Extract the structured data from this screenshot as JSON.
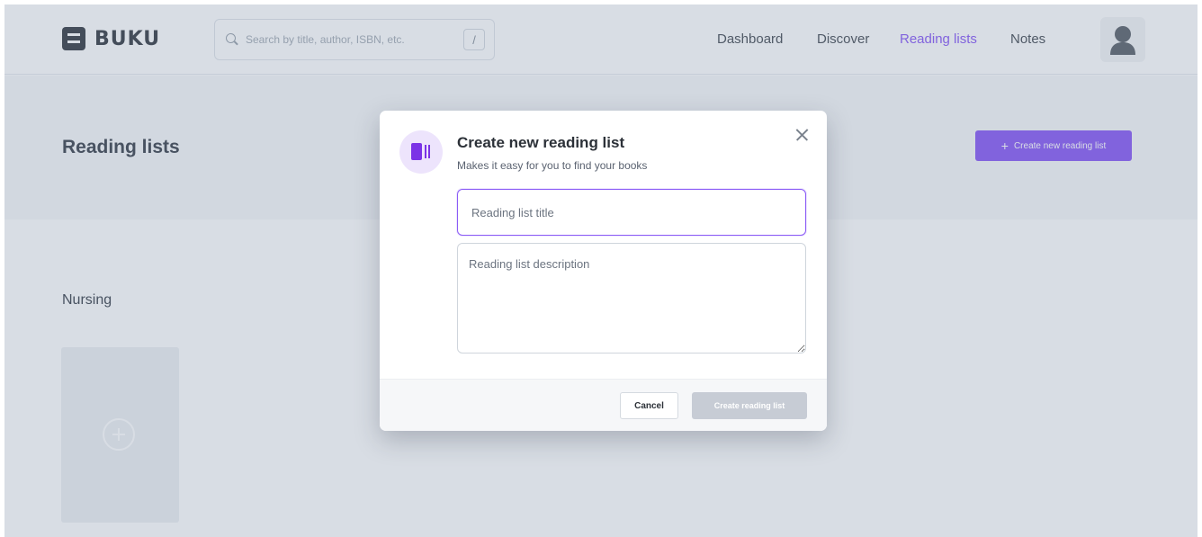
{
  "header": {
    "brand": "BUKU",
    "search_placeholder": "Search by title, author, ISBN, etc.",
    "search_shortcut": "/",
    "nav": [
      {
        "label": "Dashboard",
        "active": false
      },
      {
        "label": "Discover",
        "active": false
      },
      {
        "label": "Reading lists",
        "active": true
      },
      {
        "label": "Notes",
        "active": false
      }
    ]
  },
  "page": {
    "title": "Reading lists",
    "create_button_label": "Create new reading list",
    "section_title": "Nursing"
  },
  "modal": {
    "title": "Create new reading list",
    "subtitle": "Makes it easy for you to find your books",
    "title_placeholder": "Reading list title",
    "description_placeholder": "Reading list description",
    "cancel_label": "Cancel",
    "submit_label": "Create reading list"
  },
  "colors": {
    "accent": "#8b5cf6",
    "disabled_button": "#c7ccd5"
  }
}
